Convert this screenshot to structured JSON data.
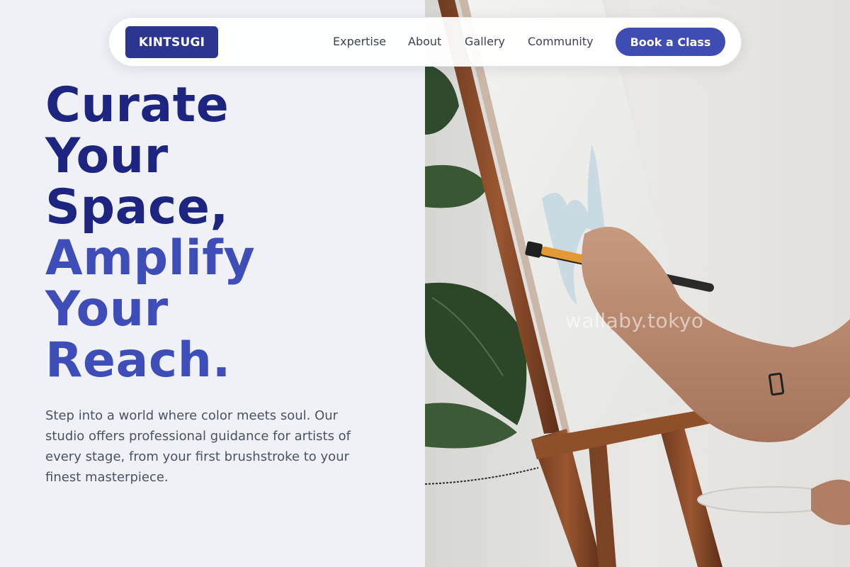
{
  "brand": {
    "logo_text": "KINTSUGI"
  },
  "nav": {
    "links": [
      {
        "label": "Expertise"
      },
      {
        "label": "About"
      },
      {
        "label": "Gallery"
      },
      {
        "label": "Community"
      }
    ],
    "cta_label": "Book a Class"
  },
  "hero": {
    "heading_lines": [
      {
        "text": "Curate",
        "tone": "dark"
      },
      {
        "text": "Your",
        "tone": "dark"
      },
      {
        "text": "Space,",
        "tone": "dark"
      },
      {
        "text": "Amplify",
        "tone": "light"
      },
      {
        "text": "Your",
        "tone": "light"
      },
      {
        "text": "Reach.",
        "tone": "light"
      }
    ],
    "body": "Step into a world where color meets soul. Our studio offers professional guidance for artists of every stage, from your first brushstroke to your finest masterpiece."
  },
  "image": {
    "watermark": "wallaby.tokyo",
    "subject": "painting-on-easel-photo"
  },
  "colors": {
    "background": "#eff1f6",
    "primary_dark": "#1e2580",
    "primary": "#3f4db8",
    "logo_bg": "#2c3590",
    "cta_bg": "#3f4db3",
    "body_text": "#4a5263"
  }
}
